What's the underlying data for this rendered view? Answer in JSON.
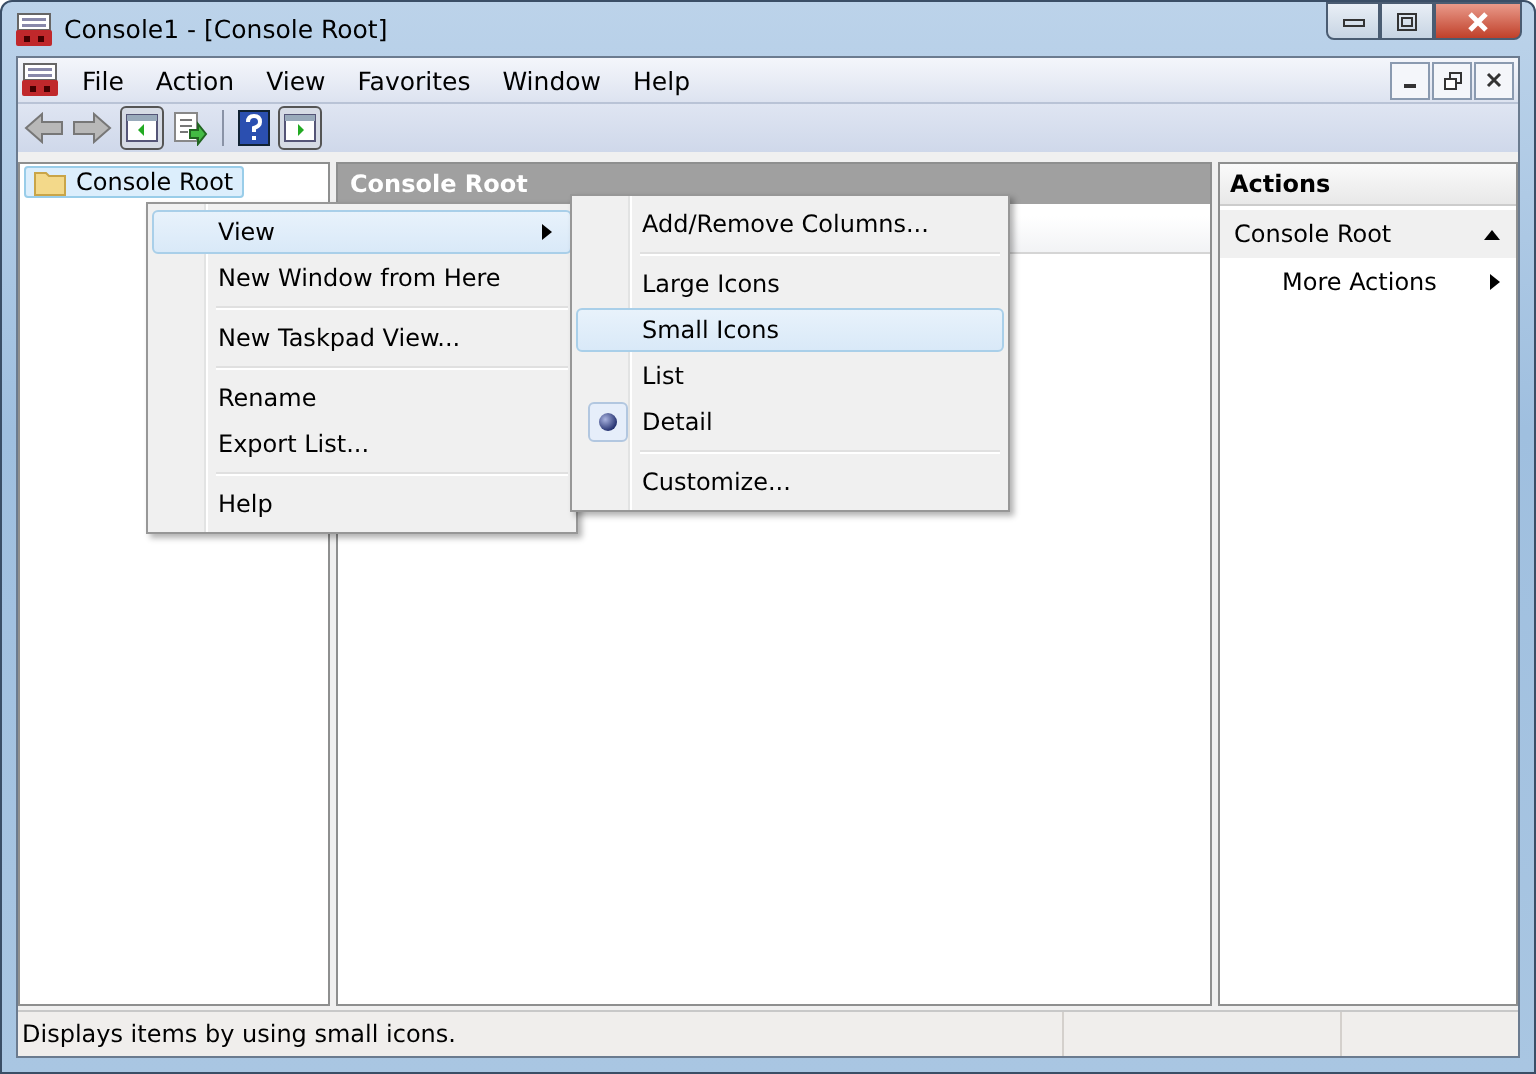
{
  "window": {
    "title": "Console1 - [Console Root]"
  },
  "menu_bar": [
    {
      "label": "File"
    },
    {
      "label": "Action"
    },
    {
      "label": "View"
    },
    {
      "label": "Favorites"
    },
    {
      "label": "Window"
    },
    {
      "label": "Help"
    }
  ],
  "tree": [
    {
      "label": "Console Root",
      "selected": true
    }
  ],
  "center_pane": {
    "title": "Console Root"
  },
  "actions_pane": {
    "title": "Actions",
    "items": [
      {
        "kind": "section",
        "label": "Console Root",
        "expanded": true
      },
      {
        "kind": "submenu",
        "label": "More Actions"
      }
    ]
  },
  "context_menu": [
    {
      "kind": "item",
      "label": "View",
      "selected": true,
      "submenu": true
    },
    {
      "kind": "item",
      "label": "New Window from Here",
      "selected": false,
      "submenu": false
    },
    {
      "kind": "separator"
    },
    {
      "kind": "item",
      "label": "New Taskpad View...",
      "selected": false,
      "submenu": false
    },
    {
      "kind": "separator"
    },
    {
      "kind": "item",
      "label": "Rename",
      "selected": false,
      "submenu": false
    },
    {
      "kind": "item",
      "label": "Export List...",
      "selected": false,
      "submenu": false
    },
    {
      "kind": "separator"
    },
    {
      "kind": "item",
      "label": "Help",
      "selected": false,
      "submenu": false
    }
  ],
  "view_submenu": [
    {
      "kind": "item",
      "label": "Add/Remove Columns...",
      "selected": false,
      "checked": false
    },
    {
      "kind": "separator"
    },
    {
      "kind": "item",
      "label": "Large Icons",
      "selected": false,
      "checked": false
    },
    {
      "kind": "item",
      "label": "Small Icons",
      "selected": true,
      "checked": false
    },
    {
      "kind": "item",
      "label": "List",
      "selected": false,
      "checked": false
    },
    {
      "kind": "item",
      "label": "Detail",
      "selected": false,
      "checked": true
    },
    {
      "kind": "separator"
    },
    {
      "kind": "item",
      "label": "Customize...",
      "selected": false,
      "checked": false
    }
  ],
  "status_bar": {
    "text": "Displays items by using small icons."
  }
}
